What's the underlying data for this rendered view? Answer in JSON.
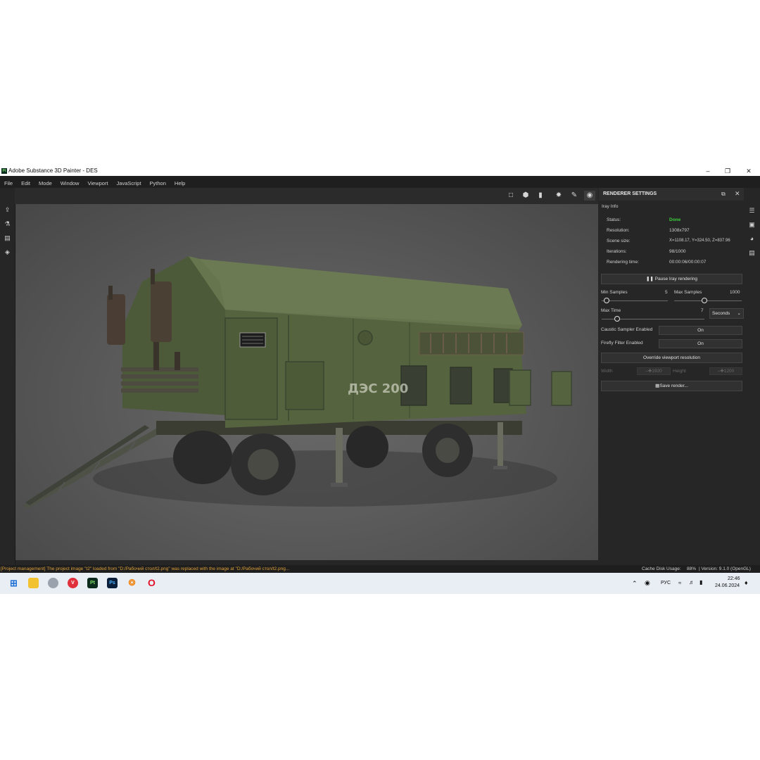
{
  "window": {
    "app_icon": "Pt",
    "title": "Adobe Substance 3D Painter - DES",
    "controls": [
      "minimize-icon",
      "restore-icon",
      "close-icon"
    ]
  },
  "menu": [
    "File",
    "Edit",
    "Mode",
    "Window",
    "Viewport",
    "JavaScript",
    "Python",
    "Help"
  ],
  "left_tools": [
    "export-icon",
    "bake-icon",
    "document-icon",
    "layers-3d-icon"
  ],
  "viewport_toolbar": [
    "frame-icon",
    "cube-icon",
    "camera-icon",
    "transform-icon",
    "paint-brush-icon",
    "screenshot-icon"
  ],
  "viewport": {
    "truck_marking": "ДЭС 200"
  },
  "panel": {
    "title": "RENDERER SETTINGS",
    "section": "Iray Info",
    "info": [
      {
        "label": "Status:",
        "value": "Done"
      },
      {
        "label": "Resolution:",
        "value": "1308x797"
      },
      {
        "label": "Scene size:",
        "value": "X=1108.17, Y=324.50, Z=837.96"
      },
      {
        "label": "Iterations:",
        "value": "98/1000"
      },
      {
        "label": "Rendering time:",
        "value": "00:00:06/00:00:07"
      }
    ],
    "status_color": "#3bd13b",
    "pause_button": "Pause Iray rendering",
    "min_samples": {
      "label": "Min Samples",
      "value": "5"
    },
    "max_samples": {
      "label": "Max Samples",
      "value": "1000"
    },
    "max_time": {
      "label": "Max Time",
      "value": "7",
      "unit": "Seconds"
    },
    "caustic": {
      "label": "Caustic Sampler Enabled",
      "value": "On"
    },
    "firefly": {
      "label": "Firefly Filter Enabled",
      "value": "On"
    },
    "override_button": "Override viewport resolution",
    "width": {
      "label": "Width",
      "value": "1920"
    },
    "height": {
      "label": "Height",
      "value": "1200"
    },
    "save_button": "Save render..."
  },
  "right_tools": [
    "layers-list-icon",
    "display-settings-icon",
    "environment-icon",
    "notes-icon"
  ],
  "status": {
    "message": "[Project management] The project image \"t2\" loaded from \"D:/Рабочий стол/t2.png\" was replaced with the image at \"D:/Рабочий стол/t2.png...",
    "cache": "Cache Disk Usage:",
    "cache_value": "88%",
    "version": "| Version: 9.1.0 (OpenGL)"
  },
  "taskbar": {
    "apps": [
      "windows-start-icon",
      "file-explorer-icon",
      "app-icon",
      "vivaldi-icon",
      "substance-painter-icon",
      "photoshop-icon",
      "blender-icon",
      "opera-icon"
    ],
    "lang": "РУС",
    "time": "22:46",
    "date": "24.06.2024"
  }
}
